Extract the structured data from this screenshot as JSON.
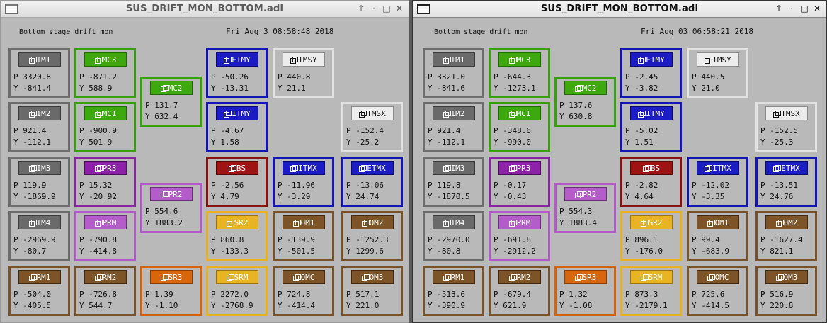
{
  "windows": [
    {
      "title": "SUS_DRIFT_MON_BOTTOM.adl",
      "caption": "Bottom stage drift mon",
      "timestamp": "Fri Aug  3 08:58:48 2018",
      "controls": [
        "↑",
        "·",
        "□",
        "✕"
      ],
      "panels": [
        {
          "label": "IM1",
          "p": "3320.8",
          "y": "-841.4"
        },
        {
          "label": "IM2",
          "p": "921.4",
          "y": "-112.1"
        },
        {
          "label": "IM3",
          "p": "119.9",
          "y": "-1869.9"
        },
        {
          "label": "IM4",
          "p": "-2969.9",
          "y": "-80.7"
        },
        {
          "label": "RM1",
          "p": "-504.0",
          "y": "-405.5"
        },
        {
          "label": "MC3",
          "p": "-871.2",
          "y": "588.9"
        },
        {
          "label": "MC1",
          "p": "-900.9",
          "y": "501.9"
        },
        {
          "label": "PR3",
          "p": "15.32",
          "y": "-20.92"
        },
        {
          "label": "PRM",
          "p": "-790.8",
          "y": "-414.8"
        },
        {
          "label": "RM2",
          "p": "-726.8",
          "y": "544.7"
        },
        {
          "label": "MC2",
          "p": "131.7",
          "y": "632.4"
        },
        {
          "label": "PR2",
          "p": "554.6",
          "y": "1883.2"
        },
        {
          "label": "SR3",
          "p": "1.39",
          "y": "-1.10"
        },
        {
          "label": "ETMY",
          "p": "-50.26",
          "y": "-13.31"
        },
        {
          "label": "ITMY",
          "p": "-4.67",
          "y": "1.58"
        },
        {
          "label": "BS",
          "p": "-2.56",
          "y": "4.79"
        },
        {
          "label": "SR2",
          "p": "860.8",
          "y": "-133.3"
        },
        {
          "label": "SRM",
          "p": "2272.0",
          "y": "-2768.9"
        },
        {
          "label": "TMSY",
          "p": "440.8",
          "y": "21.1"
        },
        {
          "label": "ITMX",
          "p": "-11.96",
          "y": "-3.29"
        },
        {
          "label": "OM1",
          "p": "-139.9",
          "y": "-501.5"
        },
        {
          "label": "OMC",
          "p": "724.8",
          "y": "-414.4"
        },
        {
          "label": "TMSX",
          "p": "-152.4",
          "y": "-25.2"
        },
        {
          "label": "ETMX",
          "p": "-13.06",
          "y": "24.74"
        },
        {
          "label": "OM2",
          "p": "-1252.3",
          "y": "1299.6"
        },
        {
          "label": "OM3",
          "p": "517.1",
          "y": "221.0"
        }
      ]
    },
    {
      "title": "SUS_DRIFT_MON_BOTTOM.adl",
      "caption": "Bottom stage drift mon",
      "timestamp": "Fri Aug 03 06:58:21 2018",
      "controls": [
        "↑",
        "·",
        "□",
        "✕"
      ],
      "panels": [
        {
          "label": "IM1",
          "p": "3321.0",
          "y": "-841.6"
        },
        {
          "label": "IM2",
          "p": "921.4",
          "y": "-112.1"
        },
        {
          "label": "IM3",
          "p": "119.8",
          "y": "-1870.5"
        },
        {
          "label": "IM4",
          "p": "-2970.0",
          "y": "-80.8"
        },
        {
          "label": "RM1",
          "p": "-513.6",
          "y": "-390.9"
        },
        {
          "label": "MC3",
          "p": "-644.3",
          "y": "-1273.1"
        },
        {
          "label": "MC1",
          "p": "-348.6",
          "y": "-990.0"
        },
        {
          "label": "PR3",
          "p": "-0.17",
          "y": "-0.43"
        },
        {
          "label": "PRM",
          "p": "-691.8",
          "y": "-2912.2"
        },
        {
          "label": "RM2",
          "p": "-679.4",
          "y": "621.9"
        },
        {
          "label": "MC2",
          "p": "137.6",
          "y": "630.8"
        },
        {
          "label": "PR2",
          "p": "554.3",
          "y": "1883.4"
        },
        {
          "label": "SR3",
          "p": "1.32",
          "y": "-1.08"
        },
        {
          "label": "ETMY",
          "p": "-2.45",
          "y": "-3.82"
        },
        {
          "label": "ITMY",
          "p": "-5.02",
          "y": "1.51"
        },
        {
          "label": "BS",
          "p": "-2.82",
          "y": "4.64"
        },
        {
          "label": "SR2",
          "p": "896.1",
          "y": "-176.0"
        },
        {
          "label": "SRM",
          "p": "873.3",
          "y": "-2179.1"
        },
        {
          "label": "TMSY",
          "p": "440.5",
          "y": "21.0"
        },
        {
          "label": "ITMX",
          "p": "-12.02",
          "y": "-3.35"
        },
        {
          "label": "OM1",
          "p": "99.4",
          "y": "-683.9"
        },
        {
          "label": "OMC",
          "p": "725.6",
          "y": "-414.5"
        },
        {
          "label": "TMSX",
          "p": "-152.5",
          "y": "-25.3"
        },
        {
          "label": "ETMX",
          "p": "-13.51",
          "y": "24.76"
        },
        {
          "label": "OM2",
          "p": "-1627.4",
          "y": "821.1"
        },
        {
          "label": "OM3",
          "p": "516.9",
          "y": "220.8"
        }
      ]
    }
  ]
}
